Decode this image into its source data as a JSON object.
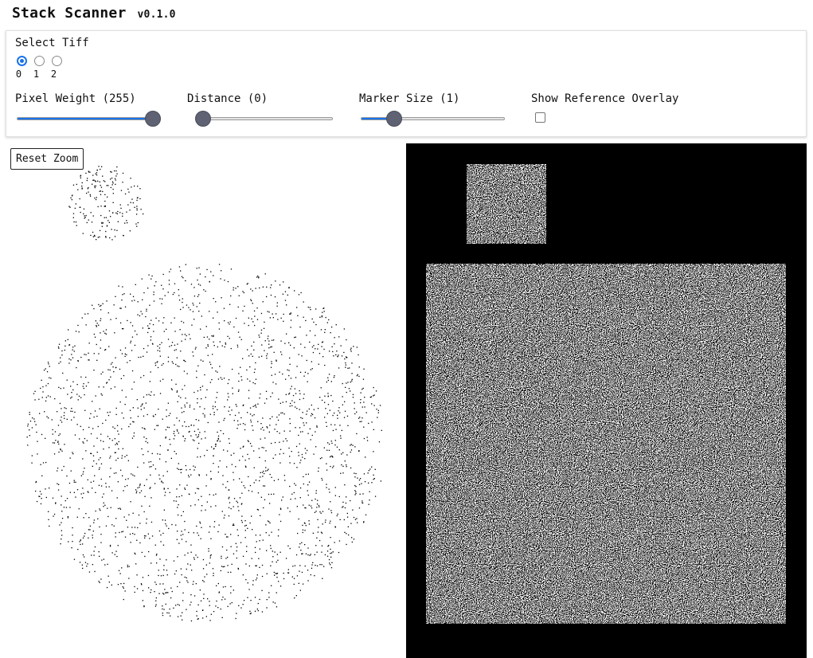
{
  "header": {
    "title": "Stack Scanner",
    "version": "v0.1.0"
  },
  "controls": {
    "select_tiff": {
      "label": "Select Tiff",
      "options": [
        "0",
        "1",
        "2"
      ],
      "selected": "0"
    },
    "pixel_weight": {
      "label": "Pixel Weight (255)",
      "value": 255,
      "min": 0,
      "max": 255
    },
    "distance": {
      "label": "Distance (0)",
      "value": 0,
      "min": 0,
      "max": 100
    },
    "marker_size": {
      "label": "Marker Size (1)",
      "value": 1,
      "min": 0,
      "max": 5
    },
    "overlay": {
      "label": "Show Reference Overlay",
      "checked": false
    }
  },
  "left_view": {
    "reset_zoom_label": "Reset Zoom",
    "background": "#ffffff",
    "point_color": "#000000"
  },
  "right_view": {
    "background": "#000000",
    "noise_colors": [
      "#ffffff",
      "#000000"
    ]
  },
  "colors": {
    "accent": "#1a73e8",
    "thumb": "#5f6272"
  }
}
